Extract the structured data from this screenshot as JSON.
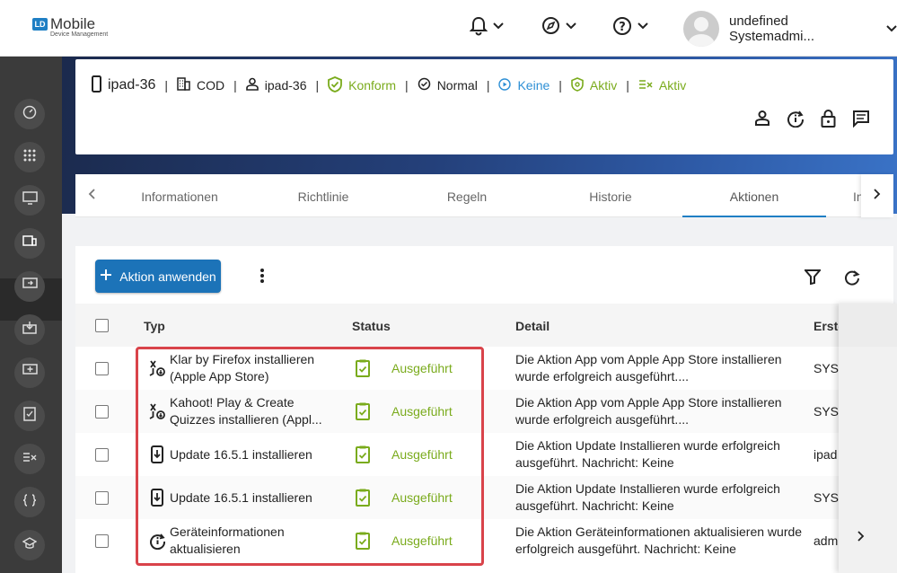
{
  "app": {
    "logo_badge": "LD",
    "logo_main": "Mobile",
    "logo_sub": "Device Management"
  },
  "user": {
    "name": "undefined Systemadmi..."
  },
  "device": {
    "name": "ipad-36",
    "ownership": "COD",
    "user": "ipad-36",
    "compliance": "Konform",
    "state": "Normal",
    "lost_mode": "Keine",
    "protection": "Aktiv",
    "policy": "Aktiv"
  },
  "tabs": [
    {
      "label": "Informationen",
      "active": false
    },
    {
      "label": "Richtlinie",
      "active": false
    },
    {
      "label": "Regeln",
      "active": false
    },
    {
      "label": "Historie",
      "active": false
    },
    {
      "label": "Aktionen",
      "active": true
    },
    {
      "label": "In",
      "active": false
    }
  ],
  "toolbar": {
    "apply_label": "Aktion anwenden"
  },
  "table": {
    "columns": [
      "Typ",
      "Status",
      "Detail",
      "Erste"
    ],
    "rows": [
      {
        "icon": "app-install-icon",
        "typ": "Klar by Firefox installieren (Apple App Store)",
        "status": "Ausgeführt",
        "detail": "Die Aktion App vom Apple App Store installieren wurde erfolgreich ausgeführt....",
        "creator": "SYST"
      },
      {
        "icon": "app-install-icon",
        "typ": "Kahoot! Play & Create Quizzes installieren (Appl...",
        "status": "Ausgeführt",
        "detail": "Die Aktion App vom Apple App Store installieren wurde erfolgreich ausgeführt....",
        "creator": "SYST"
      },
      {
        "icon": "update-icon",
        "typ": "Update 16.5.1 installieren",
        "status": "Ausgeführt",
        "detail": "Die Aktion Update Installieren wurde erfolgreich ausgeführt. Nachricht: Keine",
        "creator": "ipad"
      },
      {
        "icon": "update-icon",
        "typ": "Update 16.5.1 installieren",
        "status": "Ausgeführt",
        "detail": "Die Aktion Update Installieren wurde erfolgreich ausgeführt. Nachricht: Keine",
        "creator": "SYST"
      },
      {
        "icon": "info-refresh-icon",
        "typ": "Geräteinformationen aktualisieren",
        "status": "Ausgeführt",
        "detail": "Die Aktion Geräteinformationen aktualisieren wurde erfolgreich ausgeführt. Nachricht: Keine",
        "creator": "adm"
      }
    ]
  },
  "colors": {
    "accent": "#1c73b8",
    "success": "#7aab1c",
    "highlight": "#d9434a",
    "sidebar": "#3b3b3b"
  }
}
